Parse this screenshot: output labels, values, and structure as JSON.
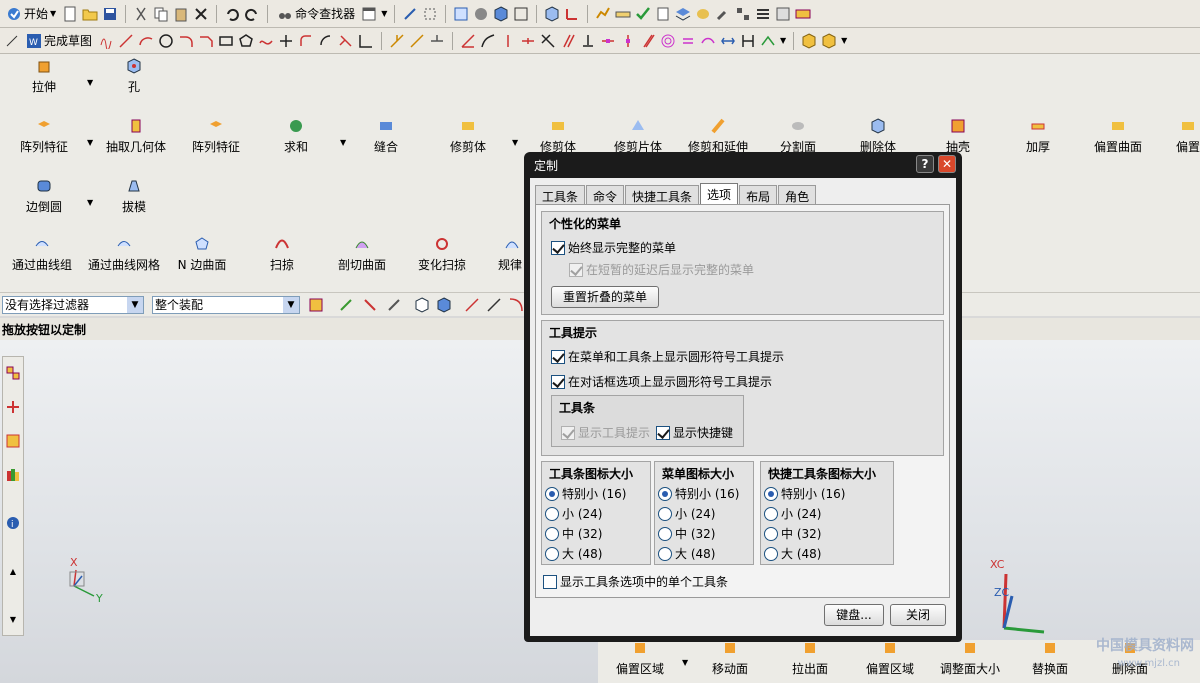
{
  "toolbar1": {
    "start_label": "开始",
    "command_finder_label": "命令查找器"
  },
  "toolbar2": {
    "finish_sketch_label": "完成草图"
  },
  "ribbon": {
    "row1": [
      "拉伸",
      "孔"
    ],
    "row2": [
      "阵列特征",
      "抽取几何体",
      "阵列特征",
      "求和",
      "缝合",
      "修剪体",
      "修剪体",
      "修剪片体",
      "修剪和延伸",
      "分割面",
      "删除体",
      "抽壳",
      "加厚",
      "偏置曲面",
      "偏置"
    ],
    "row3": [
      "边倒圆",
      "拔模"
    ],
    "row4": [
      "通过曲线组",
      "通过曲线网格",
      "N 边曲面",
      "扫掠",
      "剖切曲面",
      "变化扫掠",
      "规律"
    ]
  },
  "filterbar": {
    "filter_value": "没有选择过滤器",
    "assembly_value": "整个装配"
  },
  "hint_text": "拖放按钮以定制",
  "dialog": {
    "title": "定制",
    "help_button": "?",
    "tabs": [
      "工具条",
      "命令",
      "快捷工具条",
      "选项",
      "布局",
      "角色"
    ],
    "active_tab": "选项",
    "personalized_menu": {
      "title": "个性化的菜单",
      "always_show_full_menu": "始终显示完整的菜单",
      "show_after_delay": "在短暂的延迟后显示完整的菜单",
      "reset_button": "重置折叠的菜单"
    },
    "tooltips": {
      "title": "工具提示",
      "show_on_menus_toolbars": "在菜单和工具条上显示圆形符号工具提示",
      "show_on_dialog_options": "在对话框选项上显示圆形符号工具提示",
      "toolbar_group_title": "工具条",
      "show_tooltips": "显示工具提示",
      "show_shortcuts": "显示快捷键"
    },
    "icon_sizes": [
      {
        "title": "工具条图标大小",
        "selected": 0
      },
      {
        "title": "菜单图标大小",
        "selected": 0
      },
      {
        "title": "快捷工具条图标大小",
        "selected": 0
      }
    ],
    "size_options": [
      "特别小 (16)",
      "小 (24)",
      "中 (32)",
      "大 (48)"
    ],
    "show_single_toolbar": "显示工具条选项中的单个工具条",
    "keyboard_button": "键盘...",
    "close_button": "关闭"
  },
  "bottom_ribbon": [
    "偏置区域",
    "移动面",
    "拉出面",
    "偏置区域",
    "调整面大小",
    "替换面",
    "删除面"
  ],
  "triad": {
    "x": "X",
    "y": "Y",
    "xc": "XC",
    "zc": "ZC"
  },
  "watermark": {
    "main": "中国模具资料网",
    "sub": "www.mjzl.cn"
  },
  "colors": {
    "accent": "#2a5db0",
    "dialog_frame": "#1b1b1b",
    "close": "#d9482b"
  }
}
